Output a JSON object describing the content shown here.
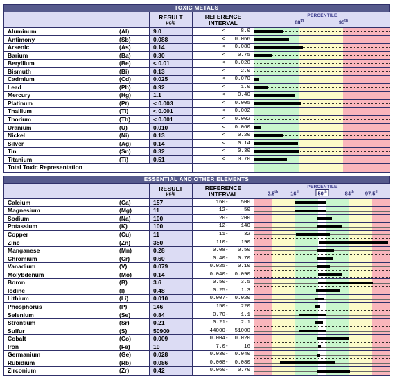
{
  "toxic": {
    "band_title": "TOXIC METALS",
    "headers": {
      "result": "RESULT",
      "result_unit": "µg/g",
      "reference": "REFERENCE\nINTERVAL",
      "reference_line1": "REFERENCE",
      "reference_line2": "INTERVAL",
      "percentile": "PERCENTILE"
    },
    "ticks": [
      {
        "label": "68",
        "sup": "th",
        "pos": 33.0
      },
      {
        "label": "95",
        "sup": "th",
        "pos": 65.5
      }
    ],
    "zones": [
      {
        "color": "#c9f7cd",
        "width": 33.0
      },
      {
        "color": "#fcfbc8",
        "width": 32.5
      },
      {
        "color": "#f9b5bb",
        "width": 34.5
      }
    ],
    "total_label": "Total Toxic Representation",
    "rows": [
      {
        "name": "Aluminum",
        "symbol": "(Al)",
        "result": "9.0",
        "ref": "<     8.0",
        "bar": 21.0
      },
      {
        "name": "Antimony",
        "symbol": "(Sb)",
        "result": "0.088",
        "ref": "<   0.066",
        "bar": 25.5
      },
      {
        "name": "Arsenic",
        "symbol": "(As)",
        "result": "0.14",
        "ref": "<   0.080",
        "bar": 36.0
      },
      {
        "name": "Barium",
        "symbol": "(Ba)",
        "result": "0.30",
        "ref": "<    0.75",
        "bar": 13.0
      },
      {
        "name": "Beryllium",
        "symbol": "(Be)",
        "result": "< 0.01",
        "ref": "<   0.020",
        "bar": 0.0
      },
      {
        "name": "Bismuth",
        "symbol": "(Bi)",
        "result": "0.13",
        "ref": "<     2.0",
        "bar": 0.0
      },
      {
        "name": "Cadmium",
        "symbol": "(Cd)",
        "result": "0.025",
        "ref": "<   0.070",
        "bar": 3.0
      },
      {
        "name": "Lead",
        "symbol": "(Pb)",
        "result": "0.92",
        "ref": "<     1.0",
        "bar": 10.0
      },
      {
        "name": "Mercury",
        "symbol": "(Hg)",
        "result": "1.1",
        "ref": "<    0.40",
        "bar": 30.0
      },
      {
        "name": "Platinum",
        "symbol": "(Pt)",
        "result": "< 0.003",
        "ref": "<   0.005",
        "bar": 34.5
      },
      {
        "name": "Thallium",
        "symbol": "(Tl)",
        "result": "< 0.001",
        "ref": "<   0.002",
        "bar": 0.0
      },
      {
        "name": "Thorium",
        "symbol": "(Th)",
        "result": "< 0.001",
        "ref": "<   0.002",
        "bar": 0.0
      },
      {
        "name": "Uranium",
        "symbol": "(U)",
        "result": "0.010",
        "ref": "<   0.060",
        "bar": 4.5
      },
      {
        "name": "Nickel",
        "symbol": "(Ni)",
        "result": "0.13",
        "ref": "<    0.20",
        "bar": 21.0
      },
      {
        "name": "Silver",
        "symbol": "(Ag)",
        "result": "0.14",
        "ref": "<    0.14",
        "bar": 32.5
      },
      {
        "name": "Tin",
        "symbol": "(Sn)",
        "result": "0.32",
        "ref": "<    0.30",
        "bar": 33.0
      },
      {
        "name": "Titanium",
        "symbol": "(Ti)",
        "result": "0.51",
        "ref": "<    0.70",
        "bar": 24.0
      }
    ]
  },
  "essential": {
    "band_title": "ESSENTIAL AND OTHER ELEMENTS",
    "headers": {
      "result": "RESULT",
      "result_unit": "µg/g",
      "reference_line1": "REFERENCE",
      "reference_line2": "INTERVAL",
      "percentile": "PERCENTILE"
    },
    "ticks": [
      {
        "label": "2.5",
        "sup": "th",
        "pos": 13.5,
        "boxed": false
      },
      {
        "label": "16",
        "sup": "th",
        "pos": 30.0,
        "boxed": false
      },
      {
        "label": "50",
        "sup": "th",
        "pos": 50.0,
        "boxed": true
      },
      {
        "label": "84",
        "sup": "th",
        "pos": 70.0,
        "boxed": false
      },
      {
        "label": "97.5",
        "sup": "th",
        "pos": 86.5,
        "boxed": false
      }
    ],
    "zones": [
      {
        "color": "#f9b5bb",
        "width": 13.5
      },
      {
        "color": "#fcfbc8",
        "width": 16.5
      },
      {
        "color": "#c9f7cd",
        "width": 17.0
      },
      {
        "color": "#ffffff",
        "width": 6.0
      },
      {
        "color": "#c9f7cd",
        "width": 17.0
      },
      {
        "color": "#fcfbc8",
        "width": 16.5
      },
      {
        "color": "#f9b5bb",
        "width": 13.5
      }
    ],
    "rows": [
      {
        "name": "Calcium",
        "symbol": "(Ca)",
        "result": "157",
        "ref": "  160-    500",
        "bar_start": 30.5,
        "bar_end": 53.0
      },
      {
        "name": "Magnesium",
        "symbol": "(Mg)",
        "result": "11",
        "ref": "   12-     50",
        "bar_start": 30.5,
        "bar_end": 53.0
      },
      {
        "name": "Sodium",
        "symbol": "(Na)",
        "result": "100",
        "ref": "   20-    200",
        "bar_start": 46.5,
        "bar_end": 57.5
      },
      {
        "name": "Potassium",
        "symbol": "(K)",
        "result": "100",
        "ref": "   12-    140",
        "bar_start": 46.5,
        "bar_end": 65.0
      },
      {
        "name": "Copper",
        "symbol": "(Cu)",
        "result": "11",
        "ref": "   11-     32",
        "bar_start": 31.0,
        "bar_end": 56.0
      },
      {
        "name": "Zinc",
        "symbol": "(Zn)",
        "result": "350",
        "ref": "  110-    190",
        "bar_start": 47.5,
        "bar_end": 99.0
      },
      {
        "name": "Manganese",
        "symbol": "(Mn)",
        "result": "0.28",
        "ref": " 0.08-   0.50",
        "bar_start": 46.5,
        "bar_end": 59.0
      },
      {
        "name": "Chromium",
        "symbol": "(Cr)",
        "result": "0.60",
        "ref": " 0.40-   0.70",
        "bar_start": 46.5,
        "bar_end": 58.0
      },
      {
        "name": "Vanadium",
        "symbol": "(V)",
        "result": "0.079",
        "ref": "0.025-   0.10",
        "bar_start": 46.5,
        "bar_end": 56.0
      },
      {
        "name": "Molybdenum",
        "symbol": "(Mo)",
        "result": "0.14",
        "ref": "0.040-  0.090",
        "bar_start": 47.0,
        "bar_end": 65.0
      },
      {
        "name": "Boron",
        "symbol": "(B)",
        "result": "3.6",
        "ref": " 0.50-    3.5",
        "bar_start": 47.0,
        "bar_end": 87.5
      },
      {
        "name": "Iodine",
        "symbol": "(I)",
        "result": "0.48",
        "ref": " 0.25-    1.3",
        "bar_start": 45.5,
        "bar_end": 63.0
      },
      {
        "name": "Lithium",
        "symbol": "(Li)",
        "result": "0.010",
        "ref": "0.007-  0.020",
        "bar_start": 44.5,
        "bar_end": 51.5
      },
      {
        "name": "Phosphorus",
        "symbol": "(P)",
        "result": "146",
        "ref": "  150-    220",
        "bar_start": 45.0,
        "bar_end": 48.0
      },
      {
        "name": "Selenium",
        "symbol": "(Se)",
        "result": "0.84",
        "ref": " 0.70-    1.1",
        "bar_start": 33.0,
        "bar_end": 53.5
      },
      {
        "name": "Strontium",
        "symbol": "(Sr)",
        "result": "0.21",
        "ref": " 0.21-    2.1",
        "bar_start": 45.0,
        "bar_end": 51.0
      },
      {
        "name": "Sulfur",
        "symbol": "(S)",
        "result": "50900",
        "ref": "44000-  51000",
        "bar_start": 33.5,
        "bar_end": 53.5
      },
      {
        "name": "Cobalt",
        "symbol": "(Co)",
        "result": "0.009",
        "ref": "0.004-  0.020",
        "bar_start": 46.5,
        "bar_end": 70.0
      },
      {
        "name": "Iron",
        "symbol": "(Fe)",
        "result": "10",
        "ref": "  7.0-     16",
        "bar_start": 47.0,
        "bar_end": 49.0
      },
      {
        "name": "Germanium",
        "symbol": "(Ge)",
        "result": "0.028",
        "ref": "0.030-  0.040",
        "bar_start": 46.5,
        "bar_end": 48.5
      },
      {
        "name": "Rubidium",
        "symbol": "(Rb)",
        "result": "0.086",
        "ref": "0.008-  0.080",
        "bar_start": 19.0,
        "bar_end": 59.5
      },
      {
        "name": "Zirconium",
        "symbol": "(Zr)",
        "result": "0.42",
        "ref": "0.060-   0.70",
        "bar_start": 46.5,
        "bar_end": 70.5
      }
    ]
  }
}
